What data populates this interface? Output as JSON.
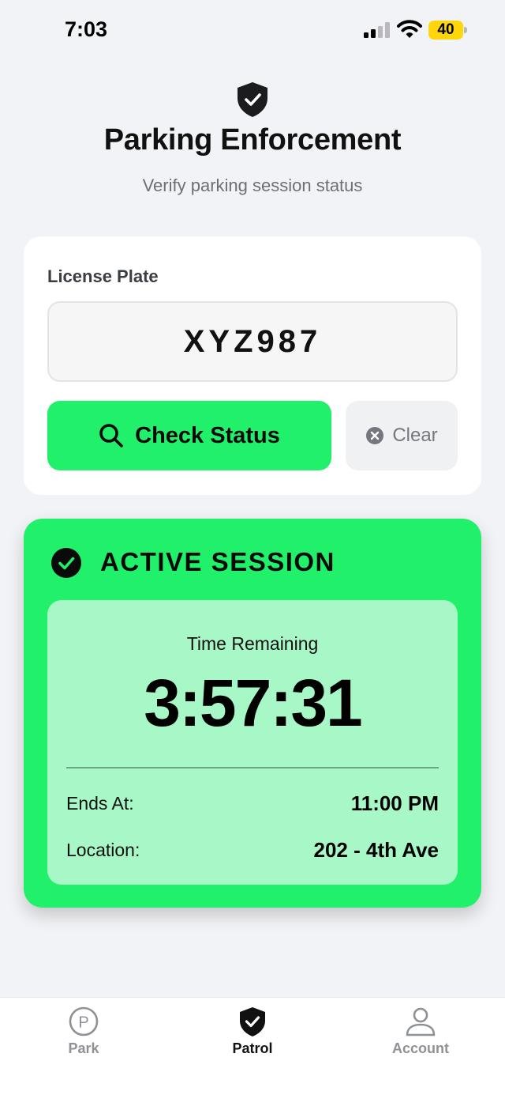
{
  "status_bar": {
    "time": "7:03",
    "battery_level": "40",
    "battery_color": "#ffd60a"
  },
  "header": {
    "icon": "shield-check-icon",
    "title": "Parking Enforcement",
    "subtitle": "Verify parking session status"
  },
  "lookup": {
    "plate_label": "License Plate",
    "plate_value": "XYZ987",
    "check_button_label": "Check Status",
    "check_button_icon": "search-icon",
    "clear_button_label": "Clear",
    "clear_button_icon": "clear-circle-icon"
  },
  "session": {
    "status_title": "ACTIVE SESSION",
    "status_icon": "check-circle-icon",
    "time_remaining_label": "Time Remaining",
    "time_remaining_value": "3:57:31",
    "ends_at_label": "Ends At:",
    "ends_at_value": "11:00 PM",
    "location_label": "Location:",
    "location_value": "202 - 4th Ave"
  },
  "tab_bar": {
    "tabs": [
      {
        "label": "Park",
        "icon": "parking-icon",
        "active": false
      },
      {
        "label": "Patrol",
        "icon": "shield-check-icon",
        "active": true
      },
      {
        "label": "Account",
        "icon": "person-icon",
        "active": false
      }
    ]
  },
  "colors": {
    "accent_green": "#20f06a",
    "session_inner": "#a7f8c6",
    "background": "#f2f3f6",
    "inactive_tab": "#8e9196"
  }
}
